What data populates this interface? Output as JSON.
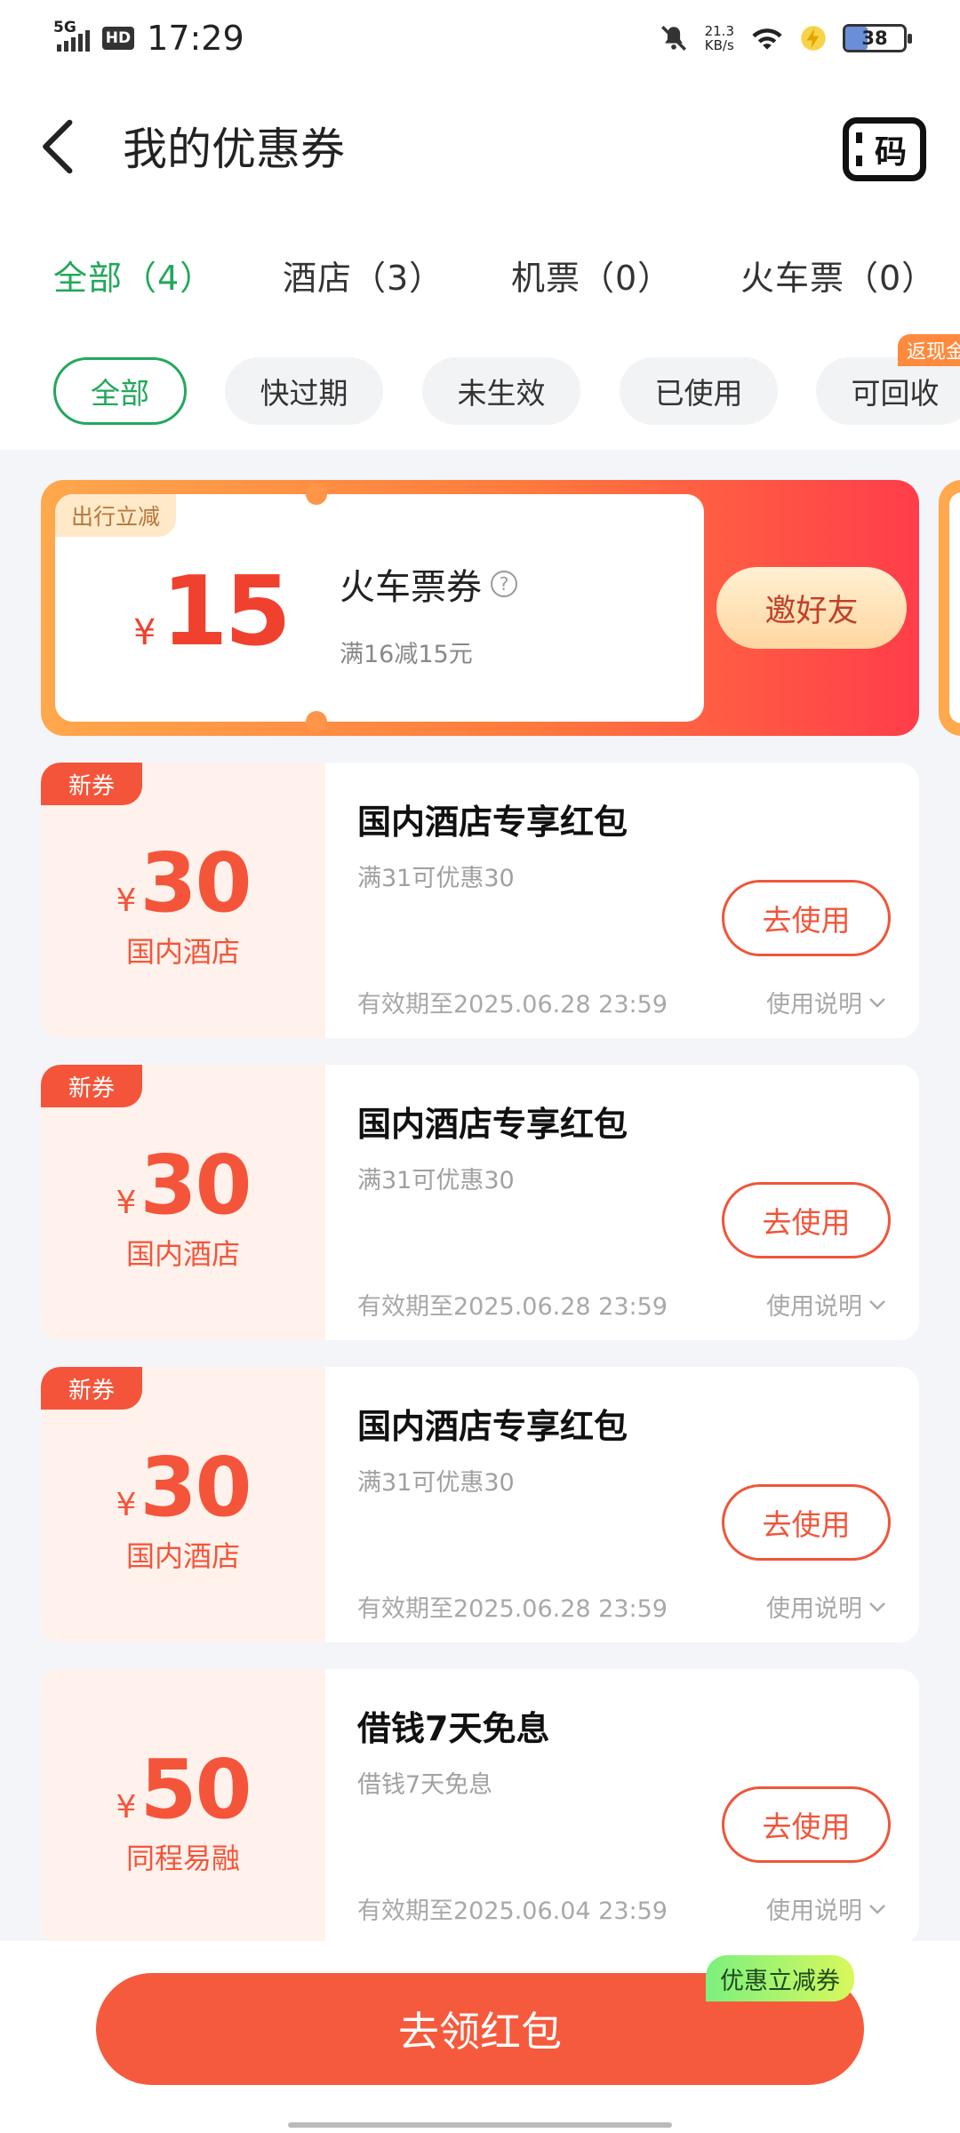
{
  "status_bar": {
    "network": "5G",
    "hd": "HD",
    "time": "17:29",
    "speed_value": "21.3",
    "speed_unit": "KB/s",
    "battery": "38"
  },
  "header": {
    "title": "我的优惠券",
    "code_label": "码"
  },
  "tabs": [
    {
      "label": "全部（4）"
    },
    {
      "label": "酒店（3）"
    },
    {
      "label": "机票（0）"
    },
    {
      "label": "火车票（0）"
    }
  ],
  "filters": [
    {
      "label": "全部"
    },
    {
      "label": "快过期"
    },
    {
      "label": "未生效"
    },
    {
      "label": "已使用"
    },
    {
      "label": "可回收"
    }
  ],
  "filter_tag": "返现金",
  "promo": {
    "tag": "出行立减",
    "currency": "¥",
    "amount": "15",
    "title": "火车票券",
    "help": "?",
    "desc": "满16减15元",
    "button": "邀好友"
  },
  "coupons": [
    {
      "new_tag": "新券",
      "currency": "¥",
      "amount": "30",
      "category": "国内酒店",
      "title": "国内酒店专享红包",
      "desc": "满31可优惠30",
      "button": "去使用",
      "expire": "有效期至2025.06.28 23:59",
      "help": "使用说明"
    },
    {
      "new_tag": "新券",
      "currency": "¥",
      "amount": "30",
      "category": "国内酒店",
      "title": "国内酒店专享红包",
      "desc": "满31可优惠30",
      "button": "去使用",
      "expire": "有效期至2025.06.28 23:59",
      "help": "使用说明"
    },
    {
      "new_tag": "新券",
      "currency": "¥",
      "amount": "30",
      "category": "国内酒店",
      "title": "国内酒店专享红包",
      "desc": "满31可优惠30",
      "button": "去使用",
      "expire": "有效期至2025.06.28 23:59",
      "help": "使用说明"
    },
    {
      "currency": "¥",
      "amount": "50",
      "category": "同程易融",
      "title": "借钱7天免息",
      "desc": "借钱7天免息",
      "button": "去使用",
      "expire": "有效期至2025.06.04 23:59",
      "help": "使用说明"
    }
  ],
  "bottom": {
    "button": "去领红包",
    "badge": "优惠立减券"
  },
  "colors": {
    "accent_green": "#22a85b",
    "coupon_red": "#f4553a",
    "cta": "#f65a3c"
  }
}
